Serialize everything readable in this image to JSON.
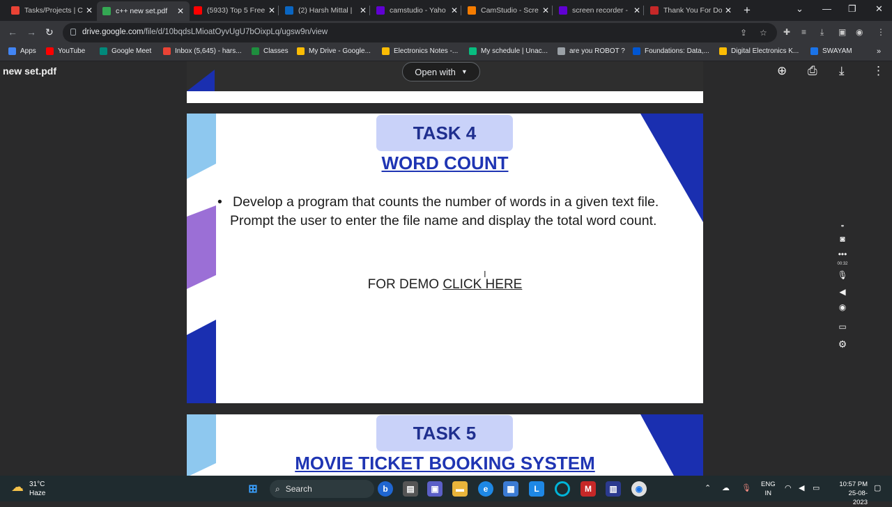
{
  "browser": {
    "tabs": [
      {
        "title": "Tasks/Projects | C",
        "favicon": "gmail-icon",
        "color": "#ea4335"
      },
      {
        "title": "c++ new set.pdf",
        "favicon": "drive-icon",
        "color": "#34a853",
        "active": true
      },
      {
        "title": "(5933) Top 5 Free",
        "favicon": "youtube-icon",
        "color": "#ff0000"
      },
      {
        "title": "(2) Harsh Mittal |",
        "favicon": "linkedin-icon",
        "color": "#0a66c2"
      },
      {
        "title": "camstudio - Yaho",
        "favicon": "yahoo-icon",
        "color": "#6001d2"
      },
      {
        "title": "CamStudio - Scre",
        "favicon": "camstudio-icon",
        "color": "#f57c00"
      },
      {
        "title": "screen recorder -",
        "favicon": "yahoo-icon",
        "color": "#6001d2"
      },
      {
        "title": "Thank You For Do",
        "favicon": "site-icon",
        "color": "#c62828"
      }
    ],
    "url_host": "drive.google.com",
    "url_path": "/file/d/10bqdsLMioatOyvUgU7bOixpLq/ugsw9n/view",
    "bookmarks": [
      {
        "label": "Apps",
        "icon": "apps-grid-icon",
        "color": "#4285f4"
      },
      {
        "label": "YouTube",
        "icon": "youtube-icon",
        "color": "#ff0000"
      },
      {
        "label": "Google Meet",
        "icon": "meet-icon",
        "color": "#00897b"
      },
      {
        "label": "Inbox (5,645) - hars...",
        "icon": "gmail-icon",
        "color": "#ea4335"
      },
      {
        "label": "Classes",
        "icon": "classes-icon",
        "color": "#1e8e3e"
      },
      {
        "label": "My Drive - Google...",
        "icon": "drive-icon",
        "color": "#fbbc04"
      },
      {
        "label": "Electronics Notes -...",
        "icon": "drive-icon",
        "color": "#fbbc04"
      },
      {
        "label": "My schedule | Unac...",
        "icon": "unacademy-icon",
        "color": "#08bd80"
      },
      {
        "label": "are you ROBOT ?",
        "icon": "link-icon",
        "color": "#9aa0a6"
      },
      {
        "label": "Foundations: Data,...",
        "icon": "coursera-icon",
        "color": "#0056d2"
      },
      {
        "label": "Digital Electronics K...",
        "icon": "drive-icon",
        "color": "#fbbc04"
      },
      {
        "label": "SWAYAM",
        "icon": "swayam-icon",
        "color": "#1a73e8"
      }
    ]
  },
  "viewer": {
    "filename": "new set.pdf",
    "open_with": "Open with"
  },
  "slide4": {
    "label": "TASK 4",
    "title": "WORD COUNT ",
    "bullet": "Develop a program that counts the number of words in a given text file. Prompt the user to enter the file name and display the total word count.",
    "demo_prefix": "FOR DEMO ",
    "demo_link": "CLICK HERE"
  },
  "slide5": {
    "label": "TASK 5",
    "title": "MOVIE TICKET BOOKING SYSTEM"
  },
  "recorder": {
    "time": "00:32"
  },
  "taskbar": {
    "temperature": "31°C",
    "condition": "Haze",
    "search": "Search",
    "lang1": "ENG",
    "lang2": "IN",
    "time": "10:57 PM",
    "date": "25-08-2023"
  },
  "colors": {
    "accent_blue": "#1f35b3",
    "label_bg": "#c9d2f9",
    "deco_light_blue": "#8ec8ef",
    "deco_purple": "#9b6fd6",
    "deco_dark_blue": "#1a2fb0"
  }
}
